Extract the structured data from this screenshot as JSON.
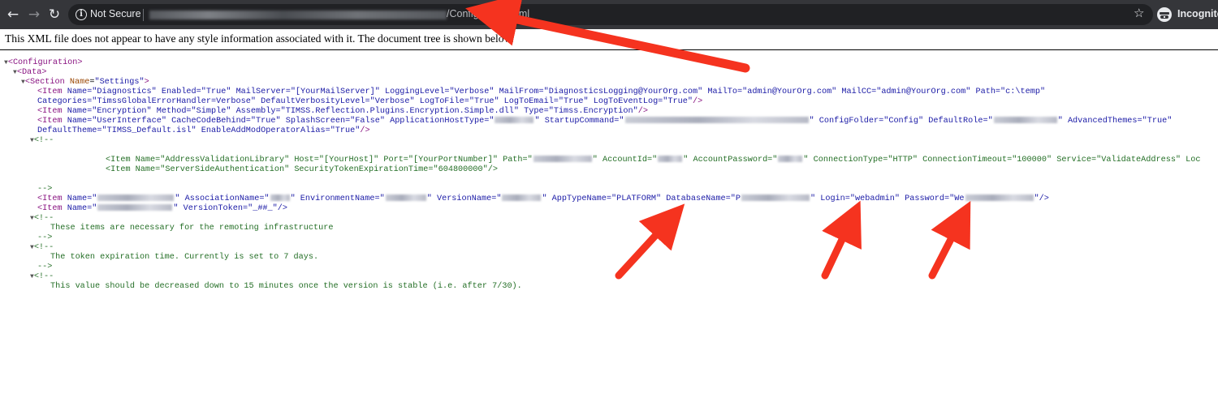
{
  "browser": {
    "back_icon": "back-arrow-icon",
    "forward_icon": "forward-arrow-icon",
    "reload_icon": "reload-icon",
    "security_label": "Not Secure",
    "url_path": "/Config/Config.xml",
    "bookmark_icon": "star-icon",
    "incognito_label": "Incognito"
  },
  "page": {
    "info_text": "This XML file does not appear to have any style information associated with it. The document tree is shown below."
  },
  "xml": {
    "configuration": "Configuration",
    "data": "Data",
    "section": "Section",
    "item": "Item",
    "name_attr": "Name",
    "settings": "\"Settings\"",
    "line_diagnostics_1": " Name=\"Diagnostics\" Enabled=\"True\" MailServer=\"[YourMailServer]\" LoggingLevel=\"Verbose\" MailFrom=\"DiagnosticsLogging@YourOrg.com\" MailTo=\"admin@YourOrg.com\" MailCC=\"admin@YourOrg.com\" Path=\"c:\\temp\"",
    "line_diagnostics_2": "Categories=\"TimssGlobalErrorHandler=Verbose\" DefaultVerbosityLevel=\"Verbose\" LogToFile=\"True\" LogToEmail=\"True\" LogToEventLog=\"True\"",
    "line_encryption": " Name=\"Encryption\" Method=\"Simple\" Assembly=\"TIMSS.Reflection.Plugins.Encryption.Simple.dll\" Type=\"Timss.Encryption\"",
    "ui_part1": " Name=\"UserInterface\" CacheCodeBehind=\"True\" SplashScreen=\"False\" ApplicationHostType=\"",
    "ui_part2": "\" StartupCommand=\"",
    "ui_part3": "\" ConfigFolder=\"Config\" DefaultRole=\"",
    "ui_part4": "\" AdvancedThemes=\"True\"",
    "ui_line2": "DefaultTheme=\"TIMSS_Default.isl\" EnableAddModOperatorAlias=\"True\"",
    "comment_open": "<!--",
    "comment_close": "-->",
    "addr_part1": "<Item Name=\"AddressValidationLibrary\" Host=\"[YourHost]\" Port=\"[YourPortNumber]\" Path=\"",
    "addr_part2": "\" AccountId=\"",
    "addr_part3": "\" AccountPassword=\"",
    "addr_part4": "\" ConnectionType=\"HTTP\" ConnectionTimeout=\"100000\" Service=\"ValidateAddress\" Loc",
    "ssa_line": "<Item Name=\"ServerSideAuthentication\" SecurityTokenExpirationTime=\"604800000\"/>",
    "db_part1": " Name=\"",
    "db_part2": "\" AssociationName=\"",
    "db_part3": "\" EnvironmentName=\"",
    "db_part4": "\" VersionName=\"",
    "db_part5": "\" AppTypeName=\"PLATFORM\" DatabaseName=\"P",
    "db_part6": "\" Login=\"webadmin\" Password=\"We",
    "db_part7": "\"/>",
    "ver_part1": " Name=\"",
    "ver_part2": "\" VersionToken=\"_##_\"/>",
    "comment_remoting": "These items are necessary for the remoting infrastructure",
    "comment_token": "The token expiration time. Currently is set to 7 days.",
    "comment_decrease": "This value should be decreased down to 15 minutes once the version is stable (i.e. after 7/30)."
  },
  "annotations": {
    "arrow_color": "#f5331f"
  }
}
